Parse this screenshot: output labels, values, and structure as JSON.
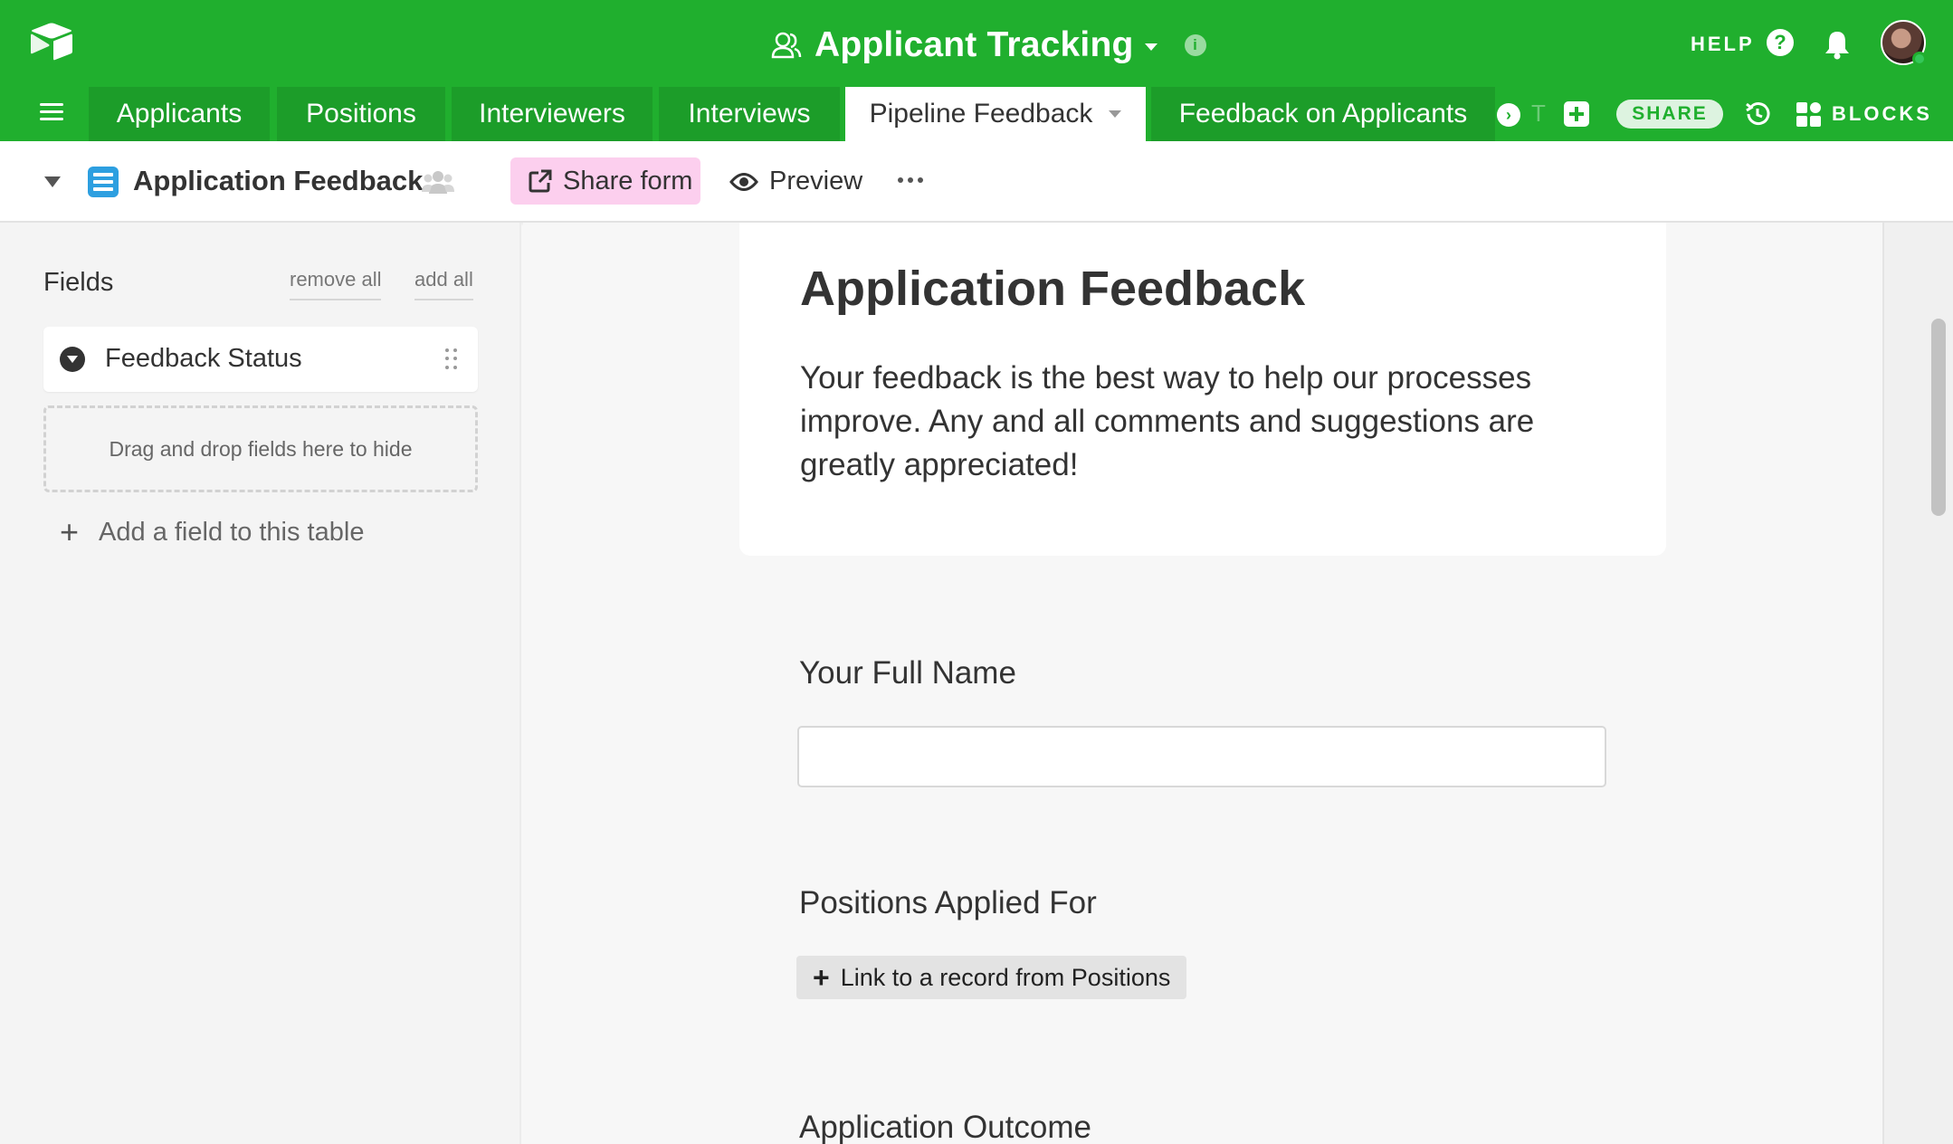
{
  "app": {
    "base_title": "Applicant Tracking",
    "help_label": "HELP"
  },
  "tabs": [
    {
      "label": "Applicants"
    },
    {
      "label": "Positions"
    },
    {
      "label": "Interviewers"
    },
    {
      "label": "Interviews"
    },
    {
      "label": "Pipeline Feedback",
      "active": true
    },
    {
      "label": "Feedback on Applicants"
    }
  ],
  "tab_overflow_ghost": "T",
  "toolbar": {
    "share_label": "SHARE",
    "blocks_label": "BLOCKS"
  },
  "view": {
    "name": "Application Feedback",
    "share_form_label": "Share form",
    "preview_label": "Preview"
  },
  "sidebar": {
    "title": "Fields",
    "remove_all_label": "remove all",
    "add_all_label": "add all",
    "hidden_fields": [
      {
        "label": "Feedback Status",
        "icon": "single-select-icon"
      }
    ],
    "dropzone_text": "Drag and drop fields here to hide",
    "add_field_label": "Add a field to this table"
  },
  "form": {
    "title": "Application Feedback",
    "description": "Your feedback is the best way to help our processes improve. Any and all comments and suggestions are greatly appreciated!",
    "questions": [
      {
        "label": "Your Full Name",
        "type": "text",
        "value": ""
      },
      {
        "label": "Positions Applied For",
        "type": "link",
        "button_label": "Link to a record from Positions"
      },
      {
        "label": "Application Outcome"
      }
    ]
  },
  "colors": {
    "brand_green": "#20af2e",
    "tab_green": "#1c9d29",
    "share_form_bg": "#fccfee",
    "form_icon_blue": "#2d9fe0"
  }
}
